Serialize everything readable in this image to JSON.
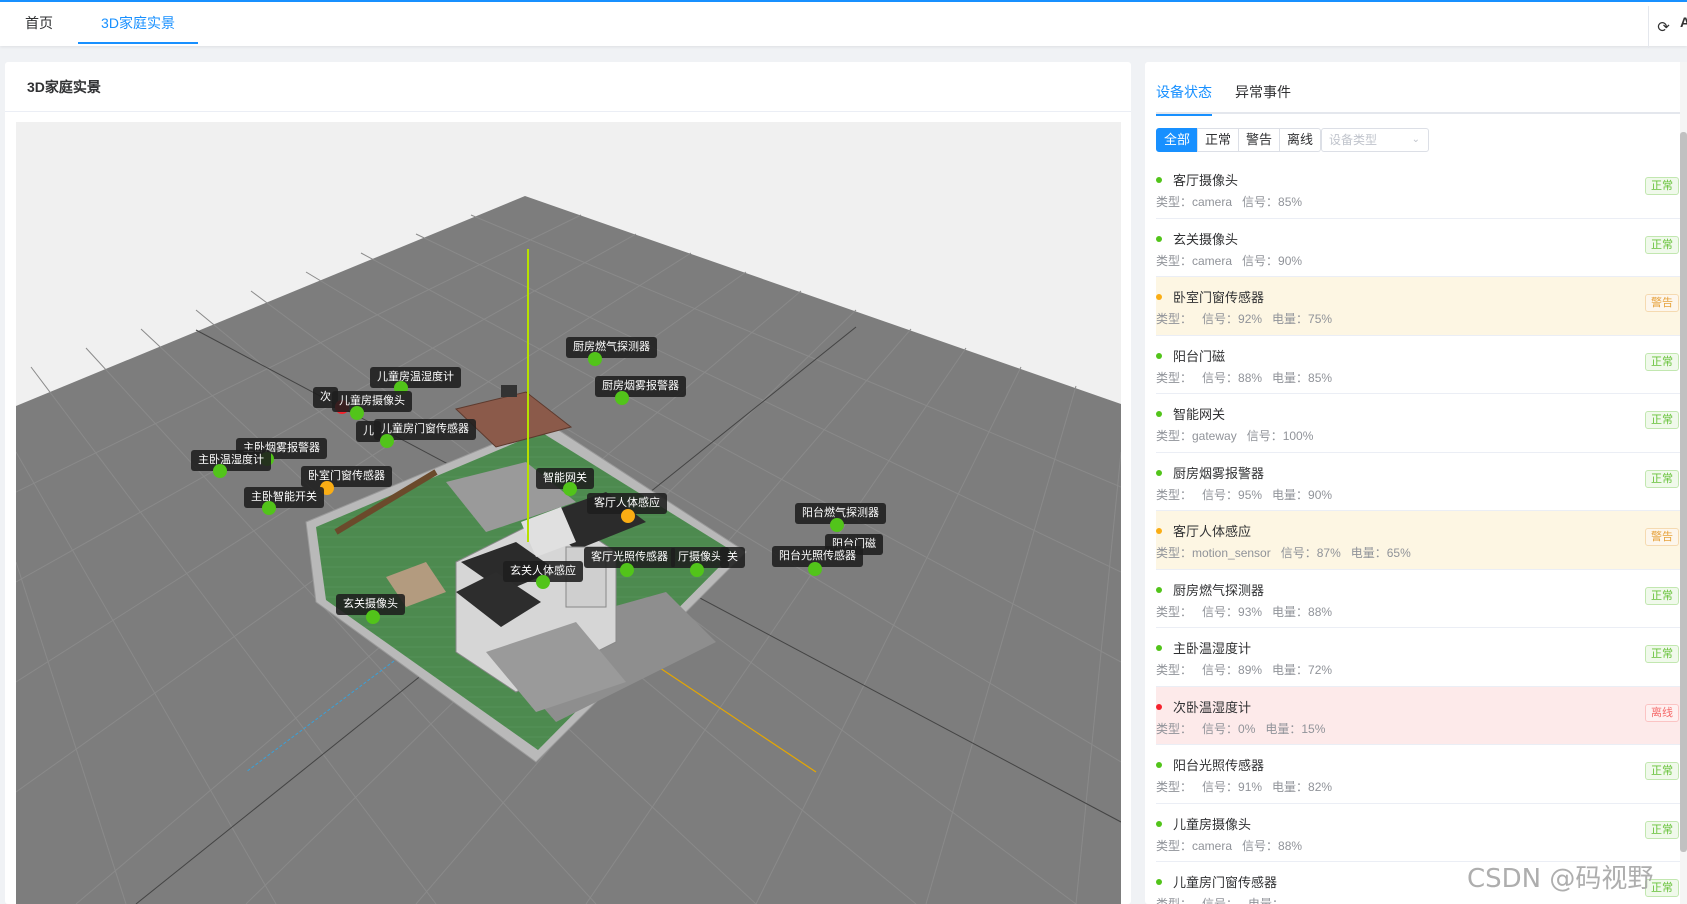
{
  "top_tabs": [
    {
      "label": "首页"
    },
    {
      "label": "3D家庭实景"
    }
  ],
  "top_edge_letter": "A",
  "scene_panel": {
    "title": "3D家庭实景"
  },
  "scene_labels": [
    {
      "text": "厨房燃气探测器",
      "status": "normal"
    },
    {
      "text": "厨房烟雾报警器",
      "status": "normal"
    },
    {
      "text": "儿童房温湿度计",
      "status": "normal"
    },
    {
      "text": "次",
      "status": "offline"
    },
    {
      "text": "儿童房摄像头",
      "status": "normal"
    },
    {
      "text": "儿",
      "status": "normal"
    },
    {
      "text": "儿童房门窗传感器",
      "status": "normal"
    },
    {
      "text": "主卧烟雾报警器",
      "status": "normal"
    },
    {
      "text": "主卧温湿度计",
      "status": "normal"
    },
    {
      "text": "卧室门窗传感器",
      "status": "warning"
    },
    {
      "text": "主卧智能开关",
      "status": "normal"
    },
    {
      "text": "智能网关",
      "status": "normal"
    },
    {
      "text": "客厅人体感应",
      "status": "warning"
    },
    {
      "text": "阳台燃气探测器",
      "status": "normal"
    },
    {
      "text": "阳台门磁",
      "status": "normal"
    },
    {
      "text": "阳台光照传感器",
      "status": "normal"
    },
    {
      "text": "客厅光照传感器",
      "status": "normal"
    },
    {
      "text": "厅摄像头",
      "status": "normal"
    },
    {
      "text": "关",
      "status": "normal"
    },
    {
      "text": "玄关人体感应",
      "status": "normal"
    },
    {
      "text": "玄关摄像头",
      "status": "normal"
    }
  ],
  "right_tabs": [
    {
      "label": "设备状态"
    },
    {
      "label": "异常事件"
    }
  ],
  "filters": [
    "全部",
    "正常",
    "警告",
    "离线"
  ],
  "type_select": {
    "placeholder": "设备类型"
  },
  "devices": [
    {
      "name": "客厅摄像头",
      "type": "类型：camera",
      "signal": "信号：85%",
      "battery": "",
      "status": "normal",
      "badge": "正常"
    },
    {
      "name": "玄关摄像头",
      "type": "类型：camera",
      "signal": "信号：90%",
      "battery": "",
      "status": "normal",
      "badge": "正常"
    },
    {
      "name": "卧室门窗传感器",
      "type": "类型：",
      "signal": "信号：92%",
      "battery": "电量：75%",
      "status": "warning",
      "badge": "警告"
    },
    {
      "name": "阳台门磁",
      "type": "类型：",
      "signal": "信号：88%",
      "battery": "电量：85%",
      "status": "normal",
      "badge": "正常"
    },
    {
      "name": "智能网关",
      "type": "类型：gateway",
      "signal": "信号：100%",
      "battery": "",
      "status": "normal",
      "badge": "正常"
    },
    {
      "name": "厨房烟雾报警器",
      "type": "类型：",
      "signal": "信号：95%",
      "battery": "电量：90%",
      "status": "normal",
      "badge": "正常"
    },
    {
      "name": "客厅人体感应",
      "type": "类型：motion_sensor",
      "signal": "信号：87%",
      "battery": "电量：65%",
      "status": "warning",
      "badge": "警告"
    },
    {
      "name": "厨房燃气探测器",
      "type": "类型：",
      "signal": "信号：93%",
      "battery": "电量：88%",
      "status": "normal",
      "badge": "正常"
    },
    {
      "name": "主卧温湿度计",
      "type": "类型：",
      "signal": "信号：89%",
      "battery": "电量：72%",
      "status": "normal",
      "badge": "正常"
    },
    {
      "name": "次卧温湿度计",
      "type": "类型：",
      "signal": "信号：0%",
      "battery": "电量：15%",
      "status": "offline",
      "badge": "离线"
    },
    {
      "name": "阳台光照传感器",
      "type": "类型：",
      "signal": "信号：91%",
      "battery": "电量：82%",
      "status": "normal",
      "badge": "正常"
    },
    {
      "name": "儿童房摄像头",
      "type": "类型：camera",
      "signal": "信号：88%",
      "battery": "",
      "status": "normal",
      "badge": "正常"
    },
    {
      "name": "儿童房门窗传感器",
      "type": "类型：",
      "signal": "信号：",
      "battery": "电量：",
      "status": "normal",
      "badge": "正常"
    }
  ],
  "status_colors": {
    "normal": "#52c41a",
    "warning": "#faad14",
    "offline": "#f5222d"
  },
  "accent_color": "#1890ff",
  "watermark": "CSDN @码视野"
}
